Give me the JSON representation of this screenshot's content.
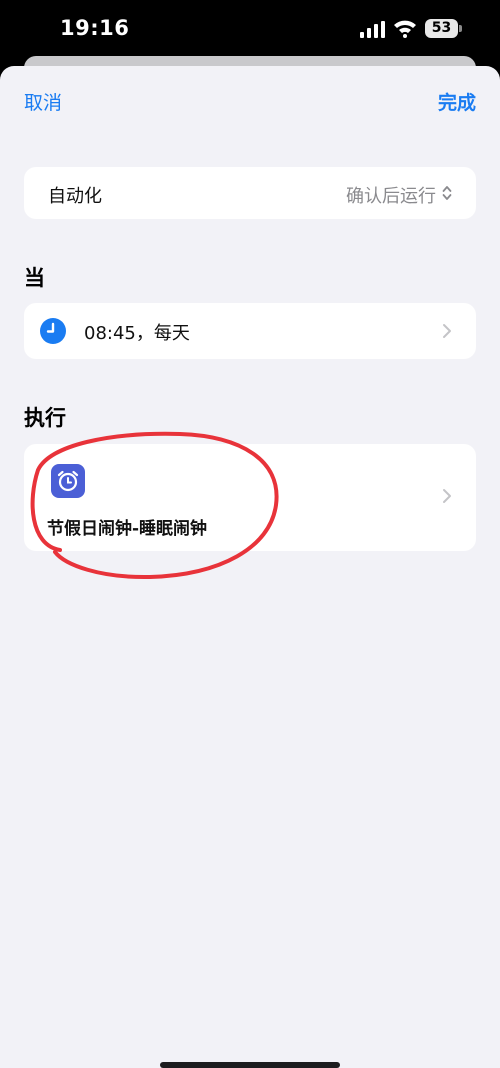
{
  "status_bar": {
    "time": "19:16",
    "battery": "53",
    "icons": [
      "signal-icon",
      "wifi-icon",
      "battery-icon"
    ]
  },
  "nav": {
    "cancel_label": "取消",
    "done_label": "完成"
  },
  "automation": {
    "label": "自动化",
    "value": "确认后运行"
  },
  "when": {
    "title": "当",
    "trigger_text": "08:45，每天"
  },
  "do": {
    "title": "执行",
    "action_text": "节假日闹钟-睡眠闹钟"
  },
  "colors": {
    "accent": "#1a7cf2",
    "sheet_background": "#f2f2f7",
    "alarm_icon": "#4b5fd6",
    "annotation": "#e8333a"
  }
}
